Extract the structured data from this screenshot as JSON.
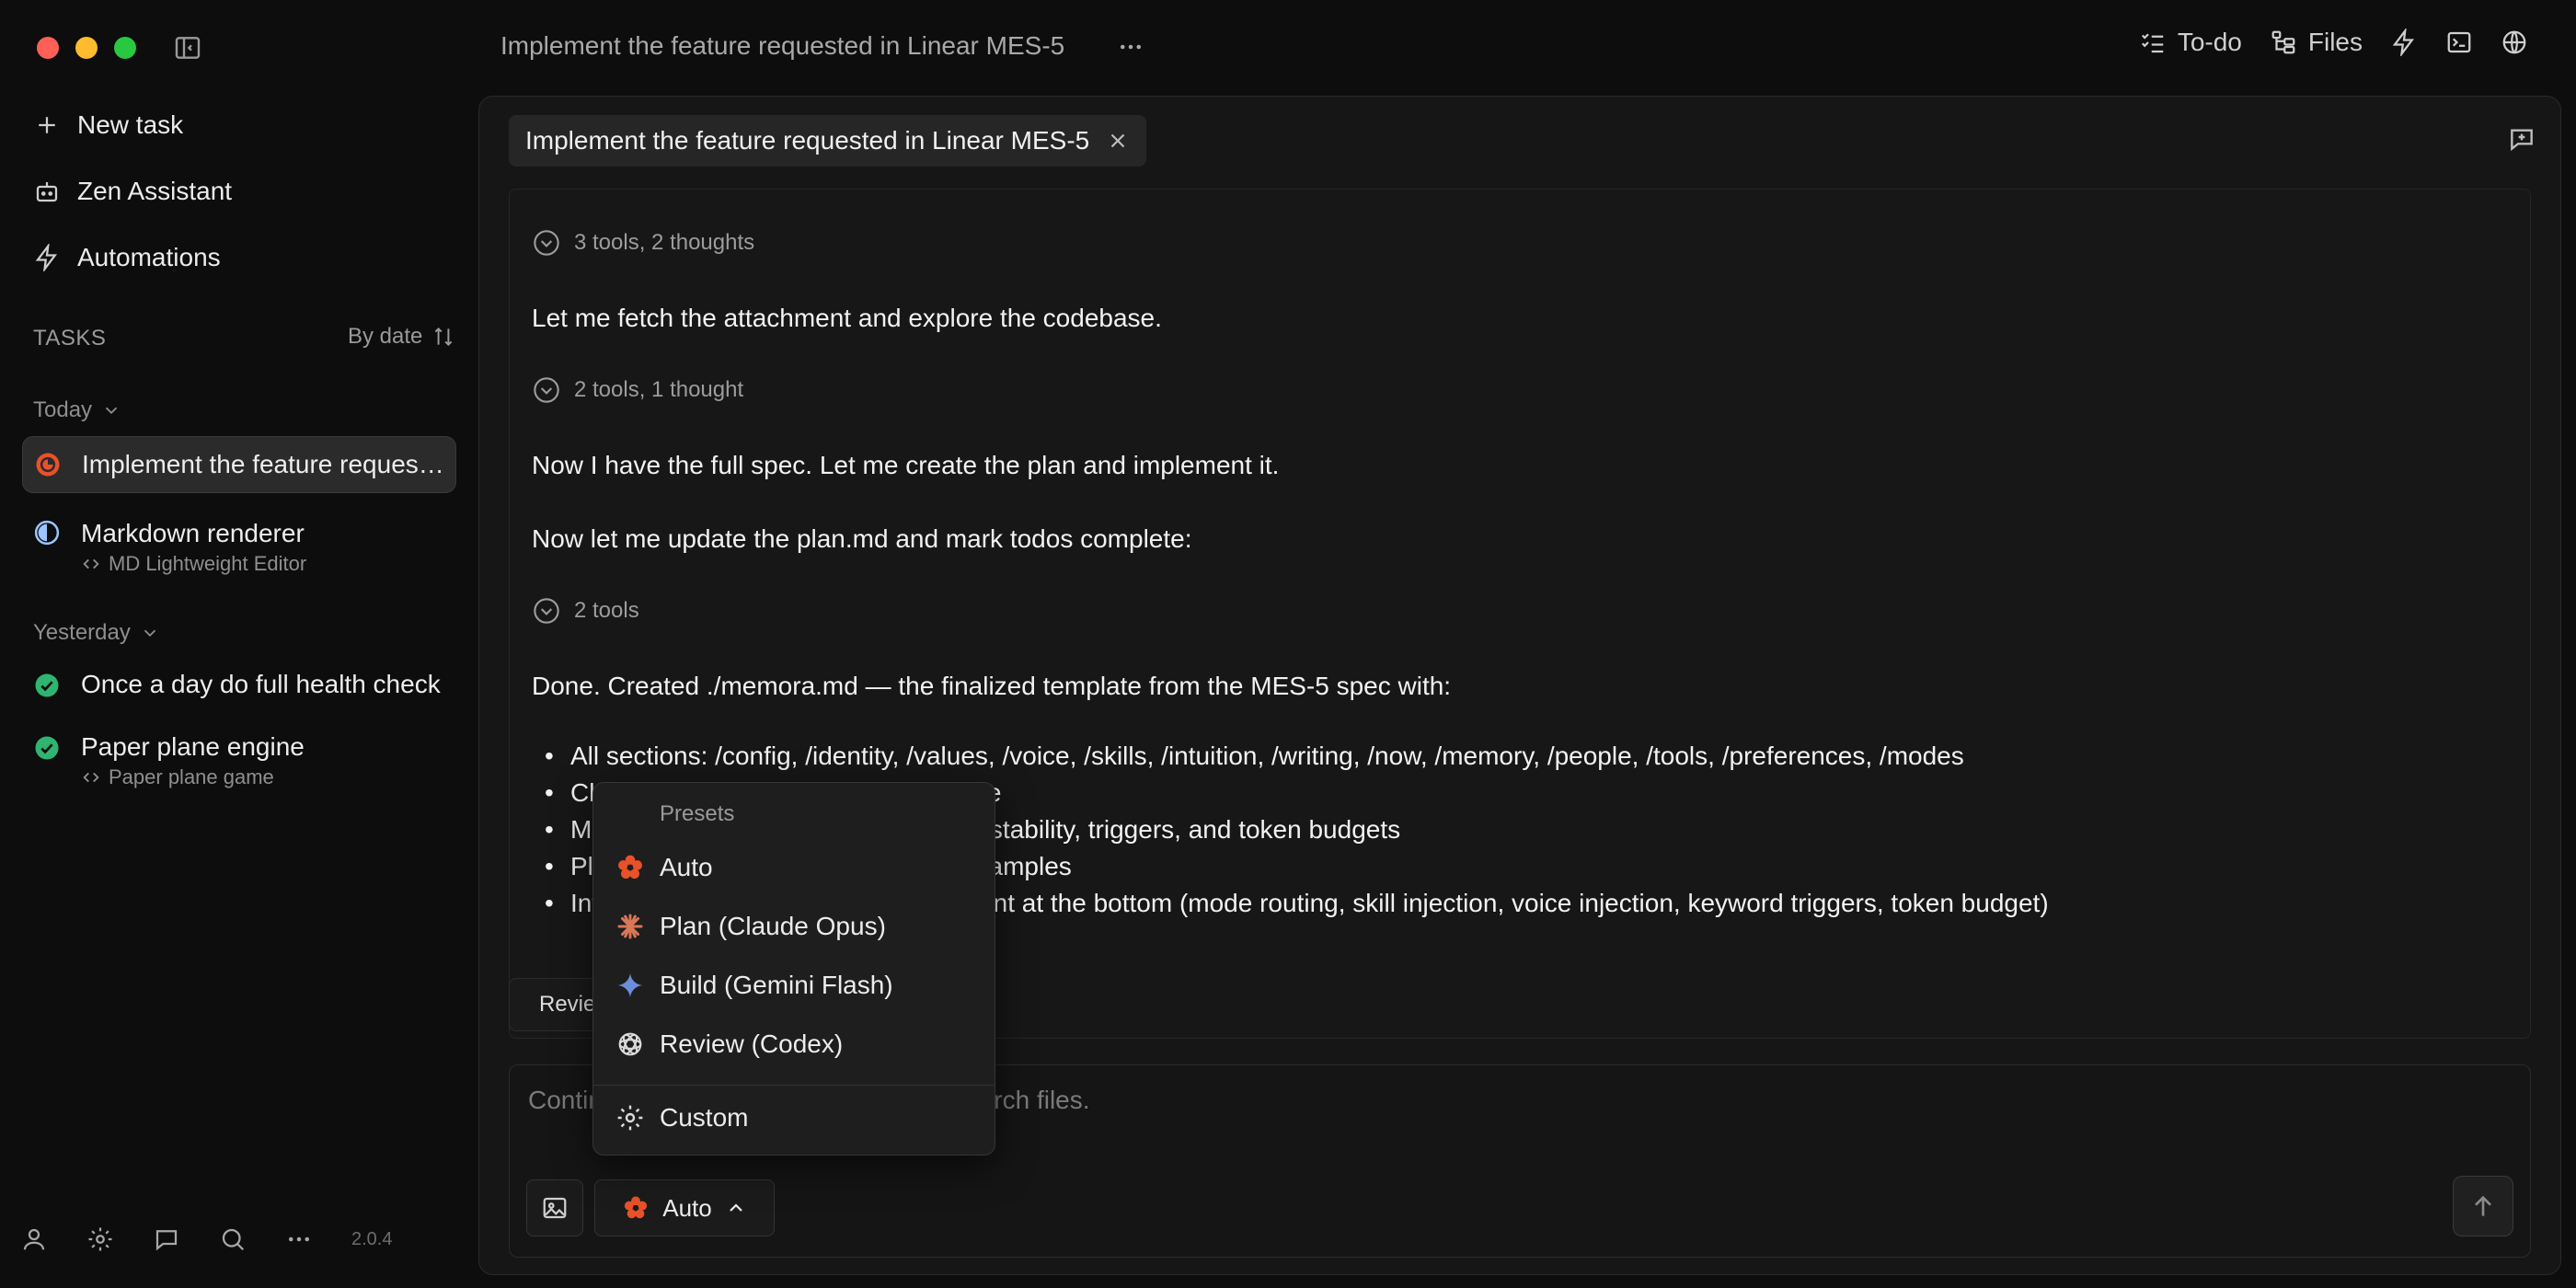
{
  "window": {
    "close_color": "#ff5f57",
    "minimize_color": "#febc2e",
    "maximize_color": "#28c840"
  },
  "sidebar": {
    "nav": [
      {
        "label": "New task",
        "icon": "plus-icon"
      },
      {
        "label": "Zen Assistant",
        "icon": "robot-icon"
      },
      {
        "label": "Automations",
        "icon": "bolt-icon"
      }
    ],
    "tasks_label": "TASKS",
    "sort_label": "By date",
    "groups": [
      {
        "label": "Today"
      },
      {
        "label": "Yesterday"
      }
    ],
    "tasks": [
      {
        "title": "Implement the feature requested in Linear MES-5",
        "subtitle": "",
        "status": "running"
      },
      {
        "title": "Markdown renderer",
        "subtitle": "MD Lightweight Editor",
        "status": "half"
      },
      {
        "title": "Once a day do full health check",
        "subtitle": "",
        "status": "done"
      },
      {
        "title": "Paper plane engine",
        "subtitle": "Paper plane game",
        "status": "done"
      }
    ],
    "version": "2.0.4"
  },
  "header": {
    "title": "Implement the feature requested in Linear MES-5",
    "todo_label": "To-do",
    "files_label": "Files"
  },
  "main": {
    "tab_title": "Implement the feature requested in Linear MES-5",
    "tools": [
      "3 tools, 2 thoughts",
      "2 tools, 1 thought",
      "2 tools"
    ],
    "messages": [
      "Let me fetch the attachment and explore the codebase.",
      "Now I have the full spec. Let me create the plan and implement it.",
      "Now let me update the plan.md and mark todos complete:",
      "Done. Created ./memora.md — the finalized template from the MES-5 spec with:"
    ],
    "bullets": [
      "All sections: /config, /identity, /values, /voice, /skills, /intuition, /writing, /now, /memory, /people, /tools, /preferences, /modes",
      "Clear heading hierarchy and structure",
      "Memory entries with ages, priorities, stability, triggers, and token budgets",
      "Placeholder values and reference examples",
      "Integration notes in an HTML comment at the bottom (mode routing, skill injection, voice injection, keyword triggers, token budget)"
    ],
    "review_label": "Review",
    "input_placeholder": "Continue the conversation, use @ to search files.",
    "mode_label": "Auto"
  },
  "dropdown": {
    "heading": "Presets",
    "presets": [
      {
        "label": "Auto",
        "icon": "flower-icon"
      },
      {
        "label": "Plan (Claude Opus)",
        "icon": "claude-icon"
      },
      {
        "label": "Build (Gemini Flash)",
        "icon": "gemini-icon"
      },
      {
        "label": "Review (Codex)",
        "icon": "openai-icon"
      }
    ],
    "custom_label": "Custom"
  },
  "colors": {
    "accent": "#e8512a",
    "success": "#2fb56f",
    "half": "#9cc4ff"
  }
}
